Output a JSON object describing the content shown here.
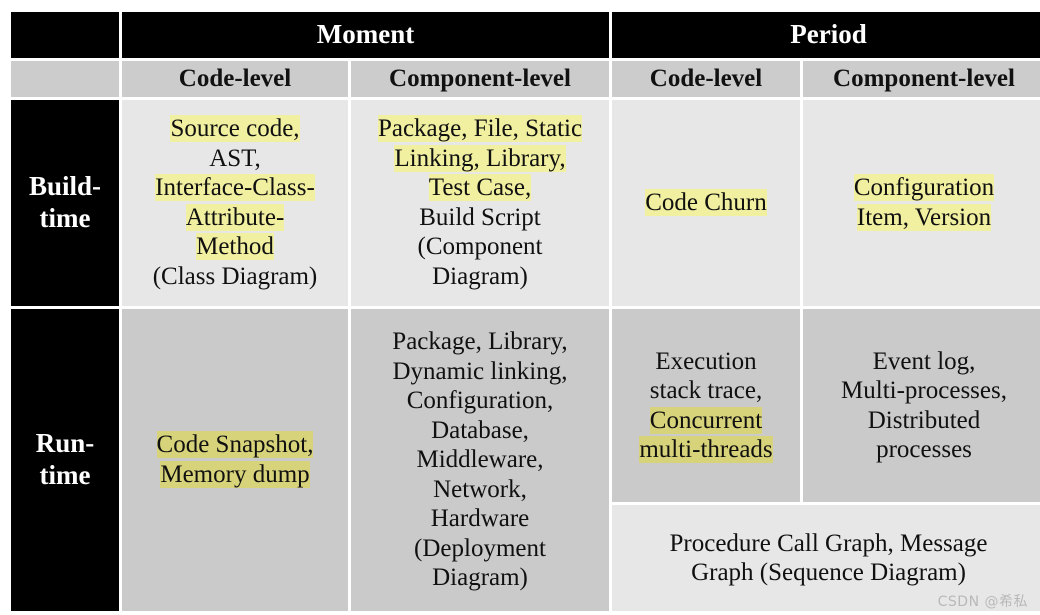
{
  "table": {
    "top_headers": [
      {
        "label": "",
        "span": 1
      },
      {
        "label": "Moment",
        "span": 2
      },
      {
        "label": "Period",
        "span": 2
      }
    ],
    "sub_headers": [
      {
        "label": ""
      },
      {
        "label": "Code-level"
      },
      {
        "label": "Component-level"
      },
      {
        "label": "Code-level"
      },
      {
        "label": "Component-level"
      }
    ],
    "rows": [
      {
        "label": "Build-\ntime",
        "label_lines": [
          "Build-",
          "time"
        ],
        "moment_code_level": {
          "lines": [
            {
              "text": "Source code,",
              "highlight": true
            },
            {
              "text": "AST,",
              "highlight": false
            },
            {
              "text": "Interface-Class-",
              "highlight": true
            },
            {
              "text": "Attribute-",
              "highlight": true
            },
            {
              "text": "Method",
              "highlight": true
            },
            {
              "text": "(Class Diagram)",
              "highlight": false
            }
          ]
        },
        "moment_component_level": {
          "lines": [
            {
              "text": "Package, File, Static",
              "highlight": true
            },
            {
              "text": "Linking, Library,",
              "highlight": true
            },
            {
              "text": "Test Case,",
              "highlight": true
            },
            {
              "text": "Build Script",
              "highlight": false
            },
            {
              "text": "(Component",
              "highlight": false
            },
            {
              "text": "Diagram)",
              "highlight": false
            }
          ]
        },
        "period_code_level": {
          "lines": [
            {
              "text": "Code Churn",
              "highlight": true
            }
          ]
        },
        "period_component_level": {
          "lines": [
            {
              "text": "Configuration",
              "highlight": true
            },
            {
              "text": "Item, Version",
              "highlight": true
            }
          ]
        }
      },
      {
        "label": "Run-\ntime",
        "label_lines": [
          "Run-",
          "time"
        ],
        "moment_code_level": {
          "lines": [
            {
              "text": "Code Snapshot,",
              "highlight": true
            },
            {
              "text": "Memory dump",
              "highlight": true
            }
          ]
        },
        "moment_component_level": {
          "lines": [
            {
              "text": "Package, Library,",
              "highlight": false
            },
            {
              "text": "Dynamic  linking,",
              "highlight": false
            },
            {
              "text": "Configuration,",
              "highlight": false
            },
            {
              "text": "Database,",
              "highlight": false
            },
            {
              "text": "Middleware,",
              "highlight": false
            },
            {
              "text": "Network,",
              "highlight": false
            },
            {
              "text": "Hardware",
              "highlight": false
            },
            {
              "text": "(Deployment",
              "highlight": false
            },
            {
              "text": "Diagram)",
              "highlight": false
            }
          ]
        },
        "period_code_level": {
          "lines": [
            {
              "text": "Execution",
              "highlight": false
            },
            {
              "text": "stack trace,",
              "highlight": false
            },
            {
              "text": "Concurrent",
              "highlight": true
            },
            {
              "text": "multi-threads",
              "highlight": true
            }
          ]
        },
        "period_component_level": {
          "lines": [
            {
              "text": "Event log,",
              "highlight": false
            },
            {
              "text": "Multi-processes,",
              "highlight": false
            },
            {
              "text": "Distributed",
              "highlight": false
            },
            {
              "text": "processes",
              "highlight": false
            }
          ]
        },
        "period_merged_footer": {
          "lines": [
            {
              "text": "Procedure Call Graph, Message",
              "highlight": false
            },
            {
              "text": "Graph (Sequence Diagram)",
              "highlight": false
            }
          ]
        }
      }
    ]
  },
  "watermark": {
    "text": "CSDN @希私"
  },
  "colors": {
    "header_black": "#000000",
    "header_gray": "#cccccc",
    "cell_light": "#e7e7e7",
    "cell_dark": "#cacaca",
    "highlight_yellow": "#f1efa0",
    "highlight_yellow_on_dark": "#d7d37a",
    "page_background": "#ffffff"
  }
}
